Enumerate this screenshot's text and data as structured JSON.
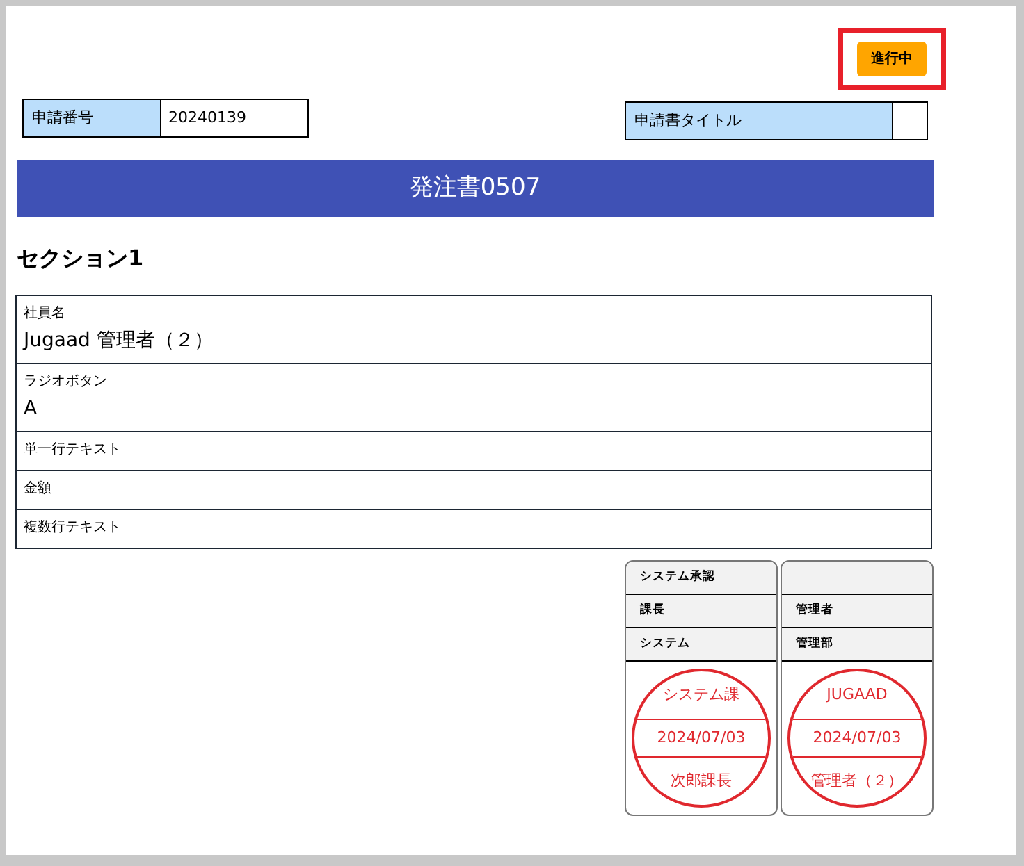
{
  "status": {
    "label": "進行中"
  },
  "application_number": {
    "label": "申請番号",
    "value": "20240139"
  },
  "application_title": {
    "label": "申請書タイトル"
  },
  "form_title": "発注書0507",
  "section": {
    "title": "セクション1",
    "fields": [
      {
        "label": "社員名",
        "value": "Jugaad 管理者（２）"
      },
      {
        "label": "ラジオボタン",
        "value": "A"
      },
      {
        "label": "単一行テキスト"
      },
      {
        "label": "金額"
      },
      {
        "label": "複数行テキスト"
      }
    ]
  },
  "approvals": [
    {
      "header": "システム承認",
      "role": "課長",
      "department": "システム",
      "stamp": {
        "top": "システム課",
        "date": "2024/07/03",
        "bottom": "次郎課長"
      }
    },
    {
      "role": "管理者",
      "department": "管理部",
      "stamp": {
        "top": "JUGAAD",
        "date": "2024/07/03",
        "bottom": "管理者（２）"
      }
    }
  ]
}
